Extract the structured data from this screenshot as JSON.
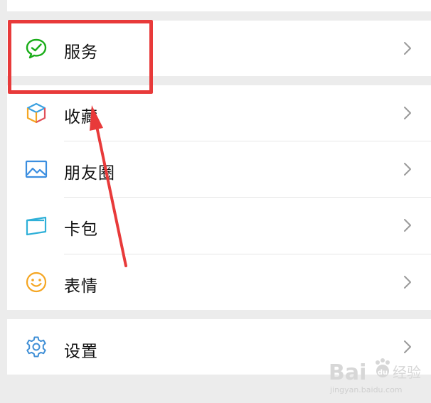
{
  "menu": {
    "service": "服务",
    "favorites": "收藏",
    "moments": "朋友圈",
    "cards": "卡包",
    "stickers": "表情",
    "settings": "设置"
  },
  "icons": {
    "service": "service-check-bubble-icon",
    "favorites": "cube-icon",
    "moments": "picture-icon",
    "cards": "card-icon",
    "stickers": "smiley-icon",
    "settings": "gear-icon",
    "chevron": "chevron-right-icon"
  },
  "colors": {
    "highlight": "#e83a3a",
    "service_green": "#1aad19",
    "moments_blue": "#3b8ee0",
    "cards_blue": "#2fb0d8",
    "smiley_yellow": "#f5a623",
    "settings_blue": "#3f8fd6"
  },
  "watermark": {
    "brand": "Bai",
    "paw": "du",
    "cn": "经验",
    "url": "jingyan.baidu.com"
  }
}
